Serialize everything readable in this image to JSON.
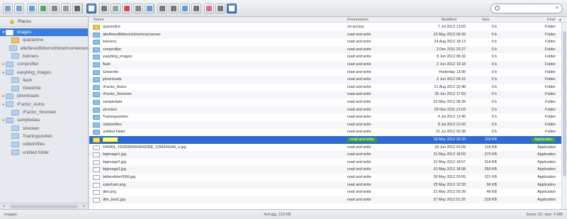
{
  "toolbar": {
    "buttons": [
      "back",
      "forward",
      "up",
      "reload",
      "home",
      "open",
      "mkdir",
      "delete",
      "view",
      "copy",
      "cut",
      "paste",
      "rename",
      "info",
      "edit",
      "resize",
      "archive",
      "extract",
      "preview",
      "help"
    ],
    "search_placeholder": "",
    "search_clear": "×"
  },
  "sidebar": {
    "places_label": "Places",
    "items": [
      {
        "label": "images",
        "arrow": "▾",
        "selected": true,
        "icon": "home"
      },
      {
        "label": "quarantine",
        "arrow": "",
        "icon": "orange"
      },
      {
        "label": "alteNewsBildernichtmehrverwenen",
        "arrow": "",
        "icon": "folder"
      },
      {
        "label": "banners",
        "arrow": "",
        "icon": "folder"
      },
      {
        "label": "comprofiler",
        "arrow": "▸",
        "icon": "folder"
      },
      {
        "label": "easyblog_images",
        "arrow": "▸",
        "icon": "folder"
      },
      {
        "label": "flash",
        "arrow": "",
        "icon": "folder"
      },
      {
        "label": "Gewichte",
        "arrow": "",
        "icon": "folder"
      },
      {
        "label": "jdownloads",
        "arrow": "▸",
        "icon": "folder"
      },
      {
        "label": "rFactor_Autos",
        "arrow": "▸",
        "icon": "folder"
      },
      {
        "label": "rFactor_Strecken",
        "arrow": "",
        "icon": "folder"
      },
      {
        "label": "sampledata",
        "arrow": "▸",
        "icon": "folder"
      },
      {
        "label": "strecken",
        "arrow": "",
        "icon": "folder"
      },
      {
        "label": "Trainingszeiten",
        "arrow": "",
        "icon": "folder"
      },
      {
        "label": "uddeimfiles",
        "arrow": "",
        "icon": "folder"
      },
      {
        "label": "untitled folder",
        "arrow": "",
        "icon": "folder"
      }
    ],
    "scroll_left": "◂",
    "scroll_right": "▸",
    "scroll_grip": "III"
  },
  "table": {
    "headers": {
      "name": "Name",
      "permissions": "Permissions",
      "modified": "Modified",
      "size": "Size",
      "kind": "Kind",
      "sort": "▴"
    },
    "rows": [
      {
        "name": "quarantine",
        "perm": "no access",
        "mod": "7 Jul 2012 13:03",
        "size": "0 b",
        "kind": "Folder",
        "icon": "orange"
      },
      {
        "name": "alteNewsBildernichtmehrverwenen",
        "perm": "read and write",
        "mod": "22 May 2012 06:39",
        "size": "0 b",
        "kind": "Folder",
        "icon": "folder"
      },
      {
        "name": "banners",
        "perm": "read and write",
        "mod": "24 Aug 2012 18:13",
        "size": "0 b",
        "kind": "Folder",
        "icon": "folder"
      },
      {
        "name": "comprofiler",
        "perm": "read and write",
        "mod": "1 Dec 2011 23:27",
        "size": "0 b",
        "kind": "Folder",
        "icon": "folder"
      },
      {
        "name": "easyblog_images",
        "perm": "read and write",
        "mod": "8 Jun 2012 06:32",
        "size": "0 b",
        "kind": "Folder",
        "icon": "folder"
      },
      {
        "name": "flash",
        "perm": "read and write",
        "mod": "2 Jun 2012 19:18",
        "size": "0 b",
        "kind": "Folder",
        "icon": "folder"
      },
      {
        "name": "Gewichte",
        "perm": "read and write",
        "mod": "Yesterday 13:06",
        "size": "0 b",
        "kind": "Folder",
        "icon": "folder"
      },
      {
        "name": "jdownloads",
        "perm": "read and write",
        "mod": "2 Jun 2012 04:15",
        "size": "0 b",
        "kind": "Folder",
        "icon": "folder"
      },
      {
        "name": "rFactor_Autos",
        "perm": "read and write",
        "mod": "21 Aug 2012 22:48",
        "size": "0 b",
        "kind": "Folder",
        "icon": "folder"
      },
      {
        "name": "rFactor_Strecken",
        "perm": "read and write",
        "mod": "28 Jun 2012 17:59",
        "size": "0 b",
        "kind": "Folder",
        "icon": "folder"
      },
      {
        "name": "sampledata",
        "perm": "read and write",
        "mod": "22 May 2012 06:39",
        "size": "0 b",
        "kind": "Folder",
        "icon": "folder"
      },
      {
        "name": "strecken",
        "perm": "read and write",
        "mod": "29 Nov 2011 21:03",
        "size": "0 b",
        "kind": "Folder",
        "icon": "folder"
      },
      {
        "name": "Trainingszeiten",
        "perm": "read and write",
        "mod": "4 Jul 2012 12:46",
        "size": "0 b",
        "kind": "Folder",
        "icon": "folder"
      },
      {
        "name": "uddeimfiles",
        "perm": "read and write",
        "mod": "8 Jul 2012 22:43",
        "size": "0 b",
        "kind": "Folder",
        "icon": "folder"
      },
      {
        "name": "untitled folder",
        "perm": "read and write",
        "mod": "21 Jul 2012 02:38",
        "size": "0 b",
        "kind": "Folder",
        "icon": "folder"
      },
      {
        "name": "4x4.jpg",
        "perm": "read and write",
        "mod": "26 May 2012 20:20",
        "size": "119 KB",
        "kind": "Application",
        "icon": "yellow",
        "selected": true
      },
      {
        "name": "544964_10150900069692068_1290241040_n.jpg",
        "perm": "read and write",
        "mod": "29 Jun 2012 01:09",
        "size": "114 KB",
        "kind": "Application",
        "icon": "file"
      },
      {
        "name": "bigimage1.jpg",
        "perm": "read and write",
        "mod": "31 May 2012 18:55",
        "size": "275 KB",
        "kind": "Application",
        "icon": "file"
      },
      {
        "name": "bigimage2.jpg",
        "perm": "read and write",
        "mod": "31 May 2012 18:57",
        "size": "314 KB",
        "kind": "Application",
        "icon": "file"
      },
      {
        "name": "bigimage3.jpg",
        "perm": "read and write",
        "mod": "31 May 2012 18:58",
        "size": "250 KB",
        "kind": "Application",
        "icon": "file"
      },
      {
        "name": "bildereilder0906.jpg",
        "perm": "read and write",
        "mod": "30 May 2012 20:55",
        "size": "231 KB",
        "kind": "Application",
        "icon": "file"
      },
      {
        "name": "caterham.png",
        "perm": "read and write",
        "mod": "25 May 2012 12:33",
        "size": "56 KB",
        "kind": "Application",
        "icon": "file"
      },
      {
        "name": "dtm.png",
        "perm": "read and write",
        "mod": "21 May 2012 02:39",
        "size": "49 KB",
        "kind": "Application",
        "icon": "file"
      },
      {
        "name": "dtm_test1.jpg",
        "perm": "read and write",
        "mod": "27 May 2012 01:25",
        "size": "218 KB",
        "kind": "Application",
        "icon": "file"
      }
    ]
  },
  "status": {
    "path": "images",
    "selection": "4x4.jpg, 119 KB",
    "summary": "items: 62, size: 4 MB"
  },
  "colors": {
    "selection": "#2f6ad1",
    "highlight_green": "#33a632",
    "highlight_yellow": "#ffff38"
  }
}
